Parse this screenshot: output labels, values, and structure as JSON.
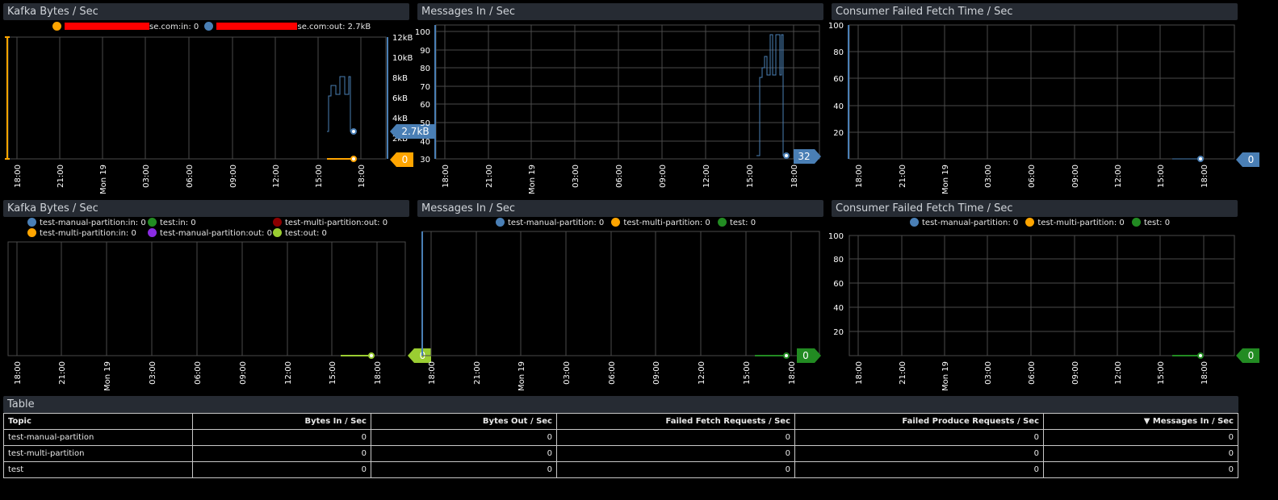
{
  "panels": {
    "p1": {
      "title": "Kafka Bytes / Sec",
      "legend": {
        "in_suffix": "se.com:in: 0",
        "out_suffix": "se.com:out: 2.7kB"
      },
      "y_ticks": [
        "2kB",
        "4kB",
        "6kB",
        "8kB",
        "10kB",
        "12kB"
      ],
      "x_ticks": [
        "18:00",
        "21:00",
        "Mon 19",
        "03:00",
        "06:00",
        "09:00",
        "12:00",
        "15:00",
        "18:00"
      ],
      "badge_blue": "2.7kB",
      "badge_orange": "0"
    },
    "p2": {
      "title": "Messages In / Sec",
      "y_ticks": [
        "30",
        "40",
        "50",
        "60",
        "70",
        "80",
        "90",
        "100"
      ],
      "x_ticks": [
        "18:00",
        "21:00",
        "Mon 19",
        "03:00",
        "06:00",
        "09:00",
        "12:00",
        "15:00",
        "18:00"
      ],
      "badge_blue": "32"
    },
    "p3": {
      "title": "Consumer Failed Fetch Time / Sec",
      "y_ticks": [
        "20",
        "40",
        "60",
        "80",
        "100"
      ],
      "x_ticks": [
        "18:00",
        "21:00",
        "Mon 19",
        "03:00",
        "06:00",
        "09:00",
        "12:00",
        "15:00",
        "18:00"
      ],
      "badge_blue": "0"
    },
    "p4": {
      "title": "Kafka Bytes / Sec",
      "legend_row1": [
        "test-manual-partition:in: 0",
        "test:in: 0",
        "test-multi-partition:out: 0"
      ],
      "legend_row2": [
        "test-multi-partition:in: 0",
        "test-manual-partition:out: 0",
        "test:out: 0"
      ],
      "x_ticks": [
        "18:00",
        "21:00",
        "Mon 19",
        "03:00",
        "06:00",
        "09:00",
        "12:00",
        "15:00",
        "18:00"
      ],
      "badge": "0"
    },
    "p5": {
      "title": "Messages In / Sec",
      "legend": [
        "test-manual-partition: 0",
        "test-multi-partition: 0",
        "test: 0"
      ],
      "x_ticks": [
        "18:00",
        "21:00",
        "Mon 19",
        "03:00",
        "06:00",
        "09:00",
        "12:00",
        "15:00",
        "18:00"
      ],
      "badge": "0"
    },
    "p6": {
      "title": "Consumer Failed Fetch Time / Sec",
      "legend": [
        "test-manual-partition: 0",
        "test-multi-partition: 0",
        "test: 0"
      ],
      "y_ticks": [
        "20",
        "40",
        "60",
        "80",
        "100"
      ],
      "x_ticks": [
        "18:00",
        "21:00",
        "Mon 19",
        "03:00",
        "06:00",
        "09:00",
        "12:00",
        "15:00",
        "18:00"
      ],
      "badge": "0"
    }
  },
  "colors": {
    "blue": "#4a7fb5",
    "orange": "#ffa500",
    "green": "#228b22",
    "darkred": "#8b0000",
    "purple": "#8a2be2",
    "lime": "#9acd32"
  },
  "table": {
    "title": "Table",
    "columns": [
      "Topic",
      "Bytes In / Sec",
      "Bytes Out / Sec",
      "Failed Fetch Requests / Sec",
      "Failed Produce Requests / Sec",
      "▼  Messages In / Sec"
    ],
    "rows": [
      [
        "test-manual-partition",
        "0",
        "0",
        "0",
        "0",
        "0"
      ],
      [
        "test-multi-partition",
        "0",
        "0",
        "0",
        "0",
        "0"
      ],
      [
        "test",
        "0",
        "0",
        "0",
        "0",
        "0"
      ]
    ]
  }
}
